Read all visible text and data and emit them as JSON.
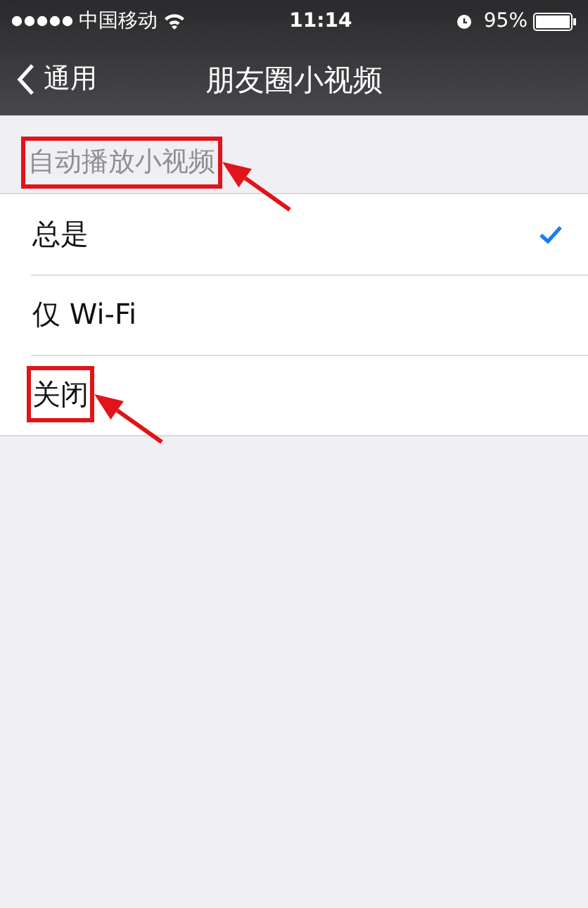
{
  "status_bar": {
    "carrier": "中国移动",
    "time": "11:14",
    "battery": "95%"
  },
  "nav_bar": {
    "back": "通用",
    "title": "朋友圈小视频"
  },
  "section": {
    "header": "自动播放小视频",
    "highlighted": true
  },
  "options": [
    {
      "label": "总是",
      "selected": true,
      "highlighted": false
    },
    {
      "label": "仅 Wi-Fi",
      "selected": false,
      "highlighted": false
    },
    {
      "label": "关闭",
      "selected": false,
      "highlighted": true
    }
  ]
}
